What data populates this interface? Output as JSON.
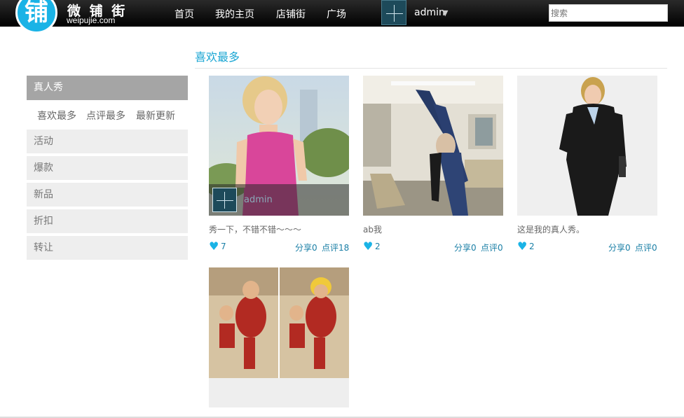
{
  "logo": {
    "glyph": "铺",
    "name_cn": "微 铺 街",
    "name_en": "weipujie.com"
  },
  "nav": [
    {
      "label": "首页"
    },
    {
      "label": "我的主页"
    },
    {
      "label": "店铺街"
    },
    {
      "label": "广场"
    }
  ],
  "user": {
    "name": "admin",
    "caret": "▼"
  },
  "search": {
    "placeholder": "搜索"
  },
  "section": {
    "title": "喜欢最多"
  },
  "sidebar": {
    "header": "真人秀",
    "subtabs": [
      {
        "label": "喜欢最多"
      },
      {
        "label": "点评最多"
      },
      {
        "label": "最新更新"
      }
    ],
    "items": [
      {
        "label": "活动"
      },
      {
        "label": "爆款"
      },
      {
        "label": "新品"
      },
      {
        "label": "折扣"
      },
      {
        "label": "转让"
      }
    ]
  },
  "cards": [
    {
      "overlay_user": "admin",
      "desc": "秀一下，不错不错～～～",
      "likes": "7",
      "share": "分享0",
      "comment": "点评18"
    },
    {
      "desc": "ab我",
      "likes": "2",
      "share": "分享0",
      "comment": "点评0"
    },
    {
      "desc": "这是我的真人秀。",
      "likes": "2",
      "share": "分享0",
      "comment": "点评0"
    },
    {
      "desc": "",
      "likes": "",
      "share": "",
      "comment": ""
    }
  ],
  "colors": {
    "accent": "#1ab3e6",
    "link": "#1a7fa6",
    "topbar": "#000000"
  }
}
